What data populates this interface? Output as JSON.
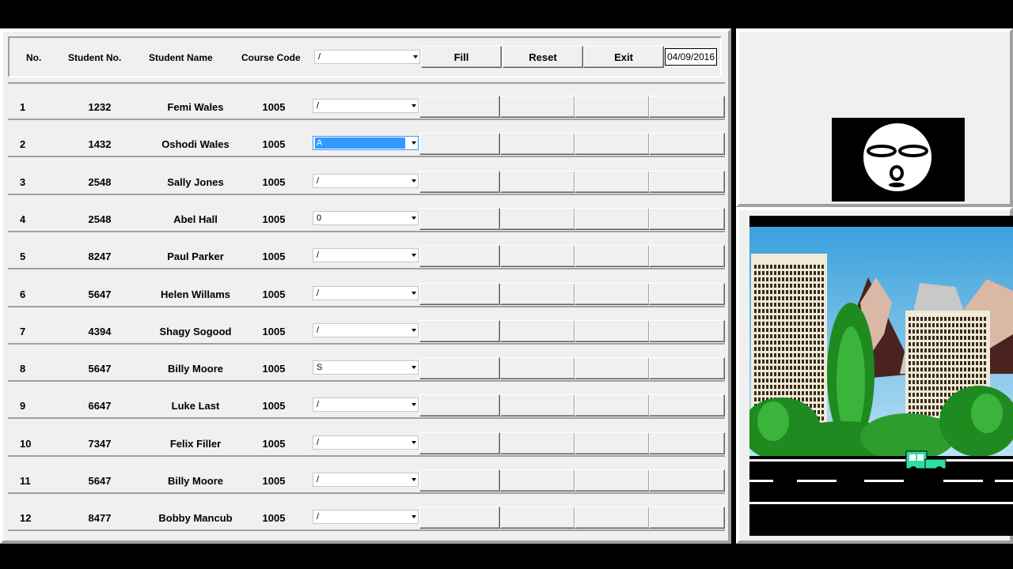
{
  "header": {
    "col_no": "No.",
    "col_student_no": "Student No.",
    "col_student_name": "Student Name",
    "col_course_code": "Course Code",
    "filter_value": "/",
    "fill_label": "Fill",
    "reset_label": "Reset",
    "exit_label": "Exit",
    "date": "04/09/2016"
  },
  "rows": [
    {
      "no": "1",
      "student_no": "1232",
      "name": "Femi Wales",
      "course": "1005",
      "grade": "/"
    },
    {
      "no": "2",
      "student_no": "1432",
      "name": "Oshodi Wales",
      "course": "1005",
      "grade": "A"
    },
    {
      "no": "3",
      "student_no": "2548",
      "name": "Sally Jones",
      "course": "1005",
      "grade": "/"
    },
    {
      "no": "4",
      "student_no": "2548",
      "name": "Abel Hall",
      "course": "1005",
      "grade": "0"
    },
    {
      "no": "5",
      "student_no": "8247",
      "name": "Paul Parker",
      "course": "1005",
      "grade": "/"
    },
    {
      "no": "6",
      "student_no": "5647",
      "name": "Helen Willams",
      "course": "1005",
      "grade": "/"
    },
    {
      "no": "7",
      "student_no": "4394",
      "name": "Shagy Sogood",
      "course": "1005",
      "grade": "/"
    },
    {
      "no": "8",
      "student_no": "5647",
      "name": "Billy Moore",
      "course": "1005",
      "grade": "S"
    },
    {
      "no": "9",
      "student_no": "6647",
      "name": "Luke Last",
      "course": "1005",
      "grade": "/"
    },
    {
      "no": "10",
      "student_no": "7347",
      "name": "Felix Filler",
      "course": "1005",
      "grade": "/"
    },
    {
      "no": "11",
      "student_no": "5647",
      "name": "Billy Moore",
      "course": "1005",
      "grade": "/"
    },
    {
      "no": "12",
      "student_no": "8477",
      "name": "Bobby Mancub",
      "course": "1005",
      "grade": "/"
    }
  ],
  "selected_row": 1,
  "icons": {
    "face": "sleeping-face-icon",
    "scene": "city-street-scene",
    "vehicle": "jeep-icon"
  },
  "colors": {
    "panel": "#f0f0f0",
    "selection": "#3399ff",
    "sky": "#5ab4e0",
    "tree": "#1f8a1f",
    "jeep": "#2ee0a0"
  }
}
